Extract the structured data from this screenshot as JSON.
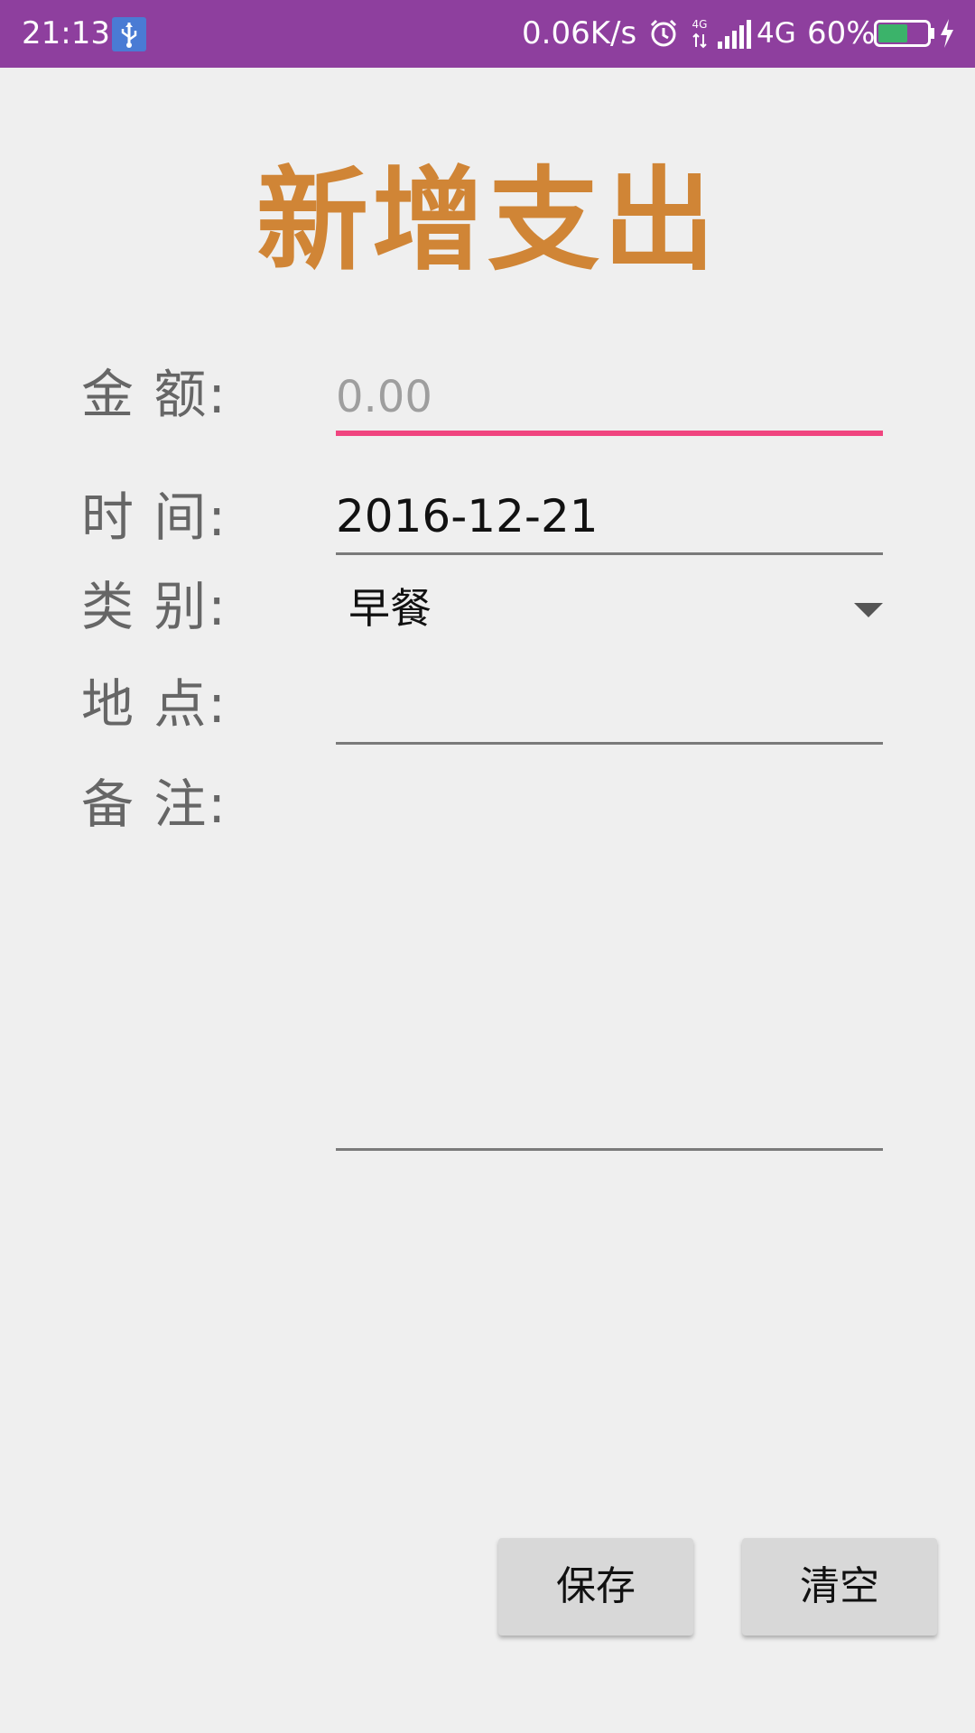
{
  "status_bar": {
    "time": "21:13",
    "net_speed": "0.06K/s",
    "data_label": "4G",
    "network_type": "4G",
    "battery_percent": "60%",
    "battery_level": 0.6,
    "colors": {
      "background": "#8e3f9e",
      "battery_fill": "#3bb36a"
    },
    "icons": [
      "usb-icon",
      "alarm-icon",
      "data-4g-icon",
      "signal-icon",
      "battery-icon",
      "charging-icon"
    ]
  },
  "page": {
    "title": "新增支出",
    "title_color": "#d08536"
  },
  "form": {
    "amount": {
      "label": "金  额:",
      "value": "",
      "placeholder": "0.00",
      "focused": true,
      "focus_color": "#f0457f"
    },
    "date": {
      "label": "时  间:",
      "value": "2016-12-21"
    },
    "category": {
      "label": "类  别:",
      "selected": "早餐"
    },
    "location": {
      "label": "地  点:",
      "value": ""
    },
    "note": {
      "label": "备  注:",
      "value": ""
    }
  },
  "actions": {
    "save_label": "保存",
    "clear_label": "清空"
  }
}
